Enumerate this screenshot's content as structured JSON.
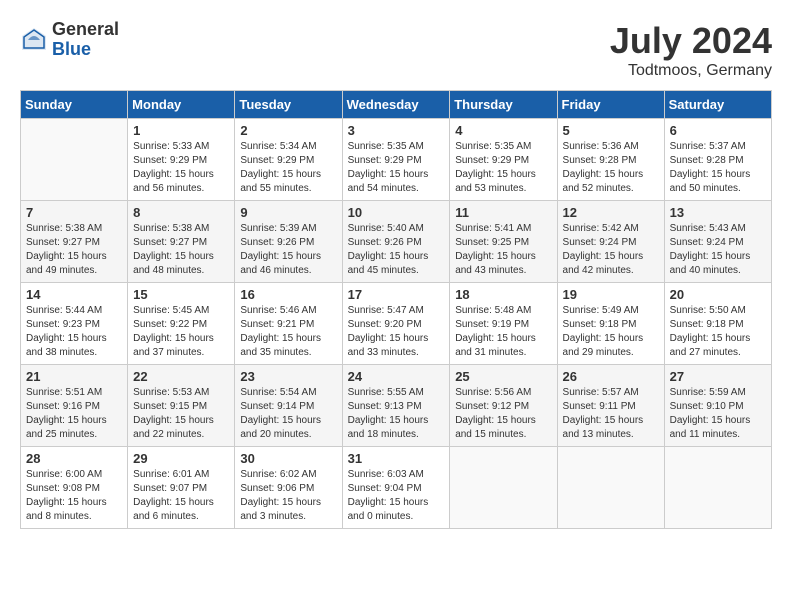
{
  "header": {
    "logo_general": "General",
    "logo_blue": "Blue",
    "month_year": "July 2024",
    "location": "Todtmoos, Germany"
  },
  "weekdays": [
    "Sunday",
    "Monday",
    "Tuesday",
    "Wednesday",
    "Thursday",
    "Friday",
    "Saturday"
  ],
  "weeks": [
    [
      {
        "day": "",
        "sunrise": "",
        "sunset": "",
        "daylight": ""
      },
      {
        "day": "1",
        "sunrise": "Sunrise: 5:33 AM",
        "sunset": "Sunset: 9:29 PM",
        "daylight": "Daylight: 15 hours and 56 minutes."
      },
      {
        "day": "2",
        "sunrise": "Sunrise: 5:34 AM",
        "sunset": "Sunset: 9:29 PM",
        "daylight": "Daylight: 15 hours and 55 minutes."
      },
      {
        "day": "3",
        "sunrise": "Sunrise: 5:35 AM",
        "sunset": "Sunset: 9:29 PM",
        "daylight": "Daylight: 15 hours and 54 minutes."
      },
      {
        "day": "4",
        "sunrise": "Sunrise: 5:35 AM",
        "sunset": "Sunset: 9:29 PM",
        "daylight": "Daylight: 15 hours and 53 minutes."
      },
      {
        "day": "5",
        "sunrise": "Sunrise: 5:36 AM",
        "sunset": "Sunset: 9:28 PM",
        "daylight": "Daylight: 15 hours and 52 minutes."
      },
      {
        "day": "6",
        "sunrise": "Sunrise: 5:37 AM",
        "sunset": "Sunset: 9:28 PM",
        "daylight": "Daylight: 15 hours and 50 minutes."
      }
    ],
    [
      {
        "day": "7",
        "sunrise": "Sunrise: 5:38 AM",
        "sunset": "Sunset: 9:27 PM",
        "daylight": "Daylight: 15 hours and 49 minutes."
      },
      {
        "day": "8",
        "sunrise": "Sunrise: 5:38 AM",
        "sunset": "Sunset: 9:27 PM",
        "daylight": "Daylight: 15 hours and 48 minutes."
      },
      {
        "day": "9",
        "sunrise": "Sunrise: 5:39 AM",
        "sunset": "Sunset: 9:26 PM",
        "daylight": "Daylight: 15 hours and 46 minutes."
      },
      {
        "day": "10",
        "sunrise": "Sunrise: 5:40 AM",
        "sunset": "Sunset: 9:26 PM",
        "daylight": "Daylight: 15 hours and 45 minutes."
      },
      {
        "day": "11",
        "sunrise": "Sunrise: 5:41 AM",
        "sunset": "Sunset: 9:25 PM",
        "daylight": "Daylight: 15 hours and 43 minutes."
      },
      {
        "day": "12",
        "sunrise": "Sunrise: 5:42 AM",
        "sunset": "Sunset: 9:24 PM",
        "daylight": "Daylight: 15 hours and 42 minutes."
      },
      {
        "day": "13",
        "sunrise": "Sunrise: 5:43 AM",
        "sunset": "Sunset: 9:24 PM",
        "daylight": "Daylight: 15 hours and 40 minutes."
      }
    ],
    [
      {
        "day": "14",
        "sunrise": "Sunrise: 5:44 AM",
        "sunset": "Sunset: 9:23 PM",
        "daylight": "Daylight: 15 hours and 38 minutes."
      },
      {
        "day": "15",
        "sunrise": "Sunrise: 5:45 AM",
        "sunset": "Sunset: 9:22 PM",
        "daylight": "Daylight: 15 hours and 37 minutes."
      },
      {
        "day": "16",
        "sunrise": "Sunrise: 5:46 AM",
        "sunset": "Sunset: 9:21 PM",
        "daylight": "Daylight: 15 hours and 35 minutes."
      },
      {
        "day": "17",
        "sunrise": "Sunrise: 5:47 AM",
        "sunset": "Sunset: 9:20 PM",
        "daylight": "Daylight: 15 hours and 33 minutes."
      },
      {
        "day": "18",
        "sunrise": "Sunrise: 5:48 AM",
        "sunset": "Sunset: 9:19 PM",
        "daylight": "Daylight: 15 hours and 31 minutes."
      },
      {
        "day": "19",
        "sunrise": "Sunrise: 5:49 AM",
        "sunset": "Sunset: 9:18 PM",
        "daylight": "Daylight: 15 hours and 29 minutes."
      },
      {
        "day": "20",
        "sunrise": "Sunrise: 5:50 AM",
        "sunset": "Sunset: 9:18 PM",
        "daylight": "Daylight: 15 hours and 27 minutes."
      }
    ],
    [
      {
        "day": "21",
        "sunrise": "Sunrise: 5:51 AM",
        "sunset": "Sunset: 9:16 PM",
        "daylight": "Daylight: 15 hours and 25 minutes."
      },
      {
        "day": "22",
        "sunrise": "Sunrise: 5:53 AM",
        "sunset": "Sunset: 9:15 PM",
        "daylight": "Daylight: 15 hours and 22 minutes."
      },
      {
        "day": "23",
        "sunrise": "Sunrise: 5:54 AM",
        "sunset": "Sunset: 9:14 PM",
        "daylight": "Daylight: 15 hours and 20 minutes."
      },
      {
        "day": "24",
        "sunrise": "Sunrise: 5:55 AM",
        "sunset": "Sunset: 9:13 PM",
        "daylight": "Daylight: 15 hours and 18 minutes."
      },
      {
        "day": "25",
        "sunrise": "Sunrise: 5:56 AM",
        "sunset": "Sunset: 9:12 PM",
        "daylight": "Daylight: 15 hours and 15 minutes."
      },
      {
        "day": "26",
        "sunrise": "Sunrise: 5:57 AM",
        "sunset": "Sunset: 9:11 PM",
        "daylight": "Daylight: 15 hours and 13 minutes."
      },
      {
        "day": "27",
        "sunrise": "Sunrise: 5:59 AM",
        "sunset": "Sunset: 9:10 PM",
        "daylight": "Daylight: 15 hours and 11 minutes."
      }
    ],
    [
      {
        "day": "28",
        "sunrise": "Sunrise: 6:00 AM",
        "sunset": "Sunset: 9:08 PM",
        "daylight": "Daylight: 15 hours and 8 minutes."
      },
      {
        "day": "29",
        "sunrise": "Sunrise: 6:01 AM",
        "sunset": "Sunset: 9:07 PM",
        "daylight": "Daylight: 15 hours and 6 minutes."
      },
      {
        "day": "30",
        "sunrise": "Sunrise: 6:02 AM",
        "sunset": "Sunset: 9:06 PM",
        "daylight": "Daylight: 15 hours and 3 minutes."
      },
      {
        "day": "31",
        "sunrise": "Sunrise: 6:03 AM",
        "sunset": "Sunset: 9:04 PM",
        "daylight": "Daylight: 15 hours and 0 minutes."
      },
      {
        "day": "",
        "sunrise": "",
        "sunset": "",
        "daylight": ""
      },
      {
        "day": "",
        "sunrise": "",
        "sunset": "",
        "daylight": ""
      },
      {
        "day": "",
        "sunrise": "",
        "sunset": "",
        "daylight": ""
      }
    ]
  ]
}
